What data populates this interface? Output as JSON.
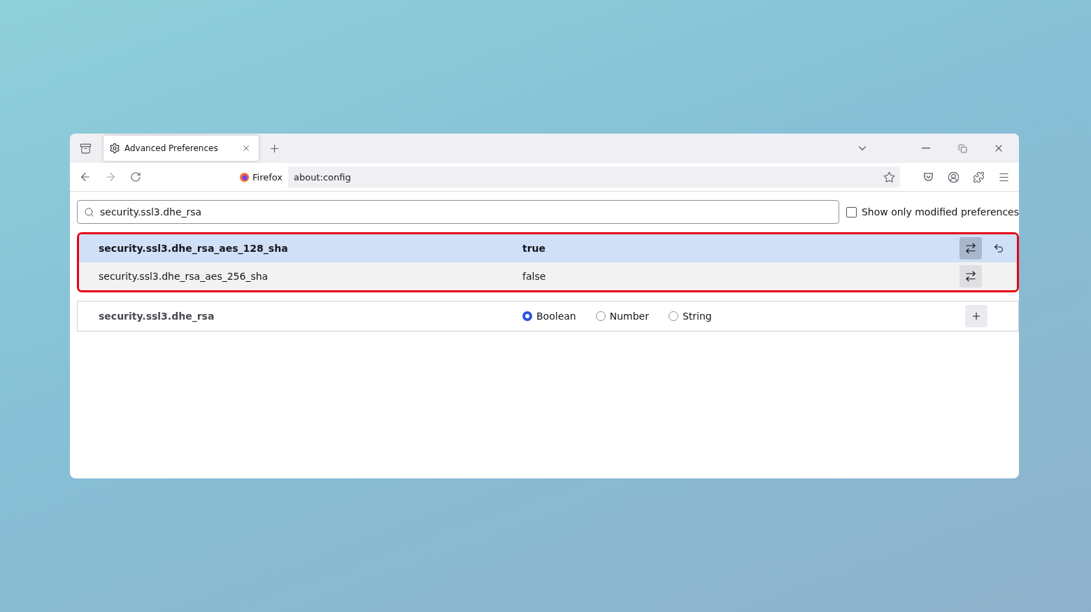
{
  "tab": {
    "title": "Advanced Preferences",
    "selected": true
  },
  "address": {
    "identity": "Firefox",
    "url": "about:config"
  },
  "search": {
    "value": "security.ssl3.dhe_rsa"
  },
  "filter": {
    "label": "Show only modified preferences",
    "checked": false
  },
  "prefs": [
    {
      "name": "security.ssl3.dhe_rsa_aes_128_sha",
      "value": "true",
      "modified": true,
      "selected": true
    },
    {
      "name": "security.ssl3.dhe_rsa_aes_256_sha",
      "value": "false",
      "modified": false,
      "selected": false
    }
  ],
  "new_pref": {
    "name": "security.ssl3.dhe_rsa",
    "types": [
      {
        "label": "Boolean",
        "selected": true
      },
      {
        "label": "Number",
        "selected": false
      },
      {
        "label": "String",
        "selected": false
      }
    ]
  }
}
